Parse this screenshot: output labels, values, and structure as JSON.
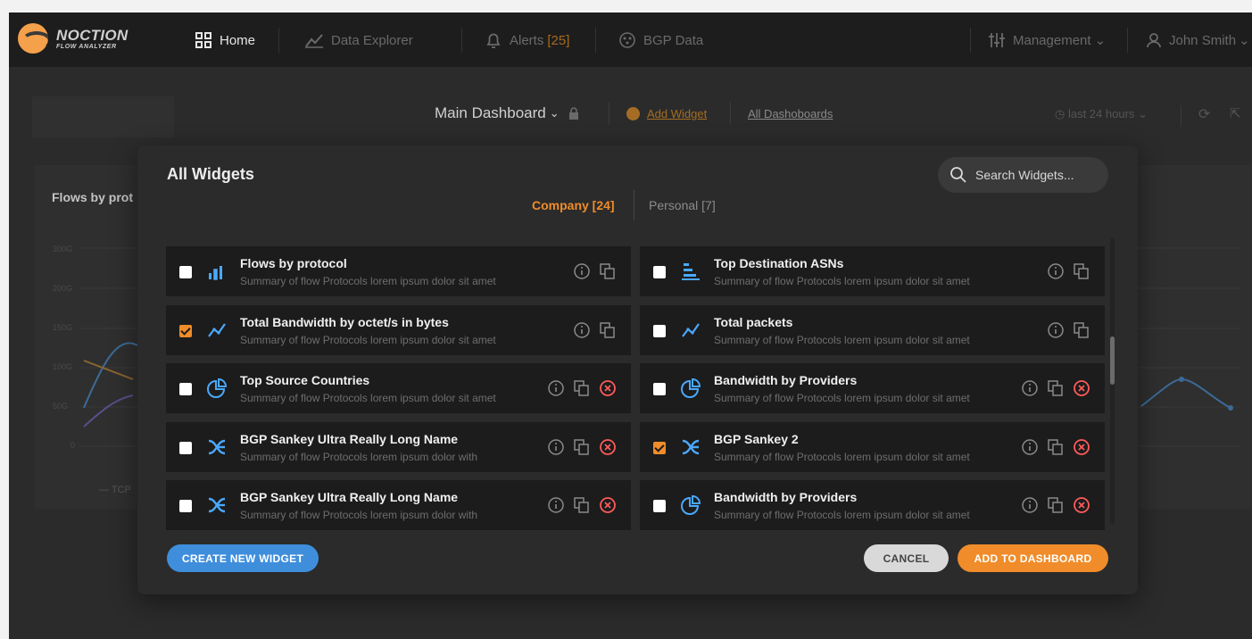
{
  "brand": {
    "name": "NOCTION",
    "sub": "FLOW ANALYZER"
  },
  "nav": {
    "home": "Home",
    "data_explorer": "Data Explorer",
    "alerts": "Alerts",
    "alerts_count": "[25]",
    "bgp_data": "BGP Data",
    "management": "Management",
    "user": "John Smith"
  },
  "dashboard": {
    "title": "Main Dashboard",
    "add_widget": "Add Widget",
    "all_dashboards": "All Dashoboards",
    "time_range": "last 24 hours",
    "chart_title": "Flows by prot",
    "y_ticks": [
      "300G",
      "200G",
      "150G",
      "100G",
      "50G",
      "0"
    ],
    "legend": "TCP"
  },
  "modal": {
    "title": "All Widgets",
    "search_placeholder": "Search Widgets...",
    "tabs": {
      "company": "Company [24]",
      "personal": "Personal [7]"
    },
    "widgets": [
      {
        "title": "Flows by protocol",
        "desc": "Summary of flow Protocols lorem ipsum dolor sit amet",
        "icon": "bar-chart-icon",
        "checked": false,
        "deletable": false
      },
      {
        "title": "Top Destination ASNs",
        "desc": "Summary of flow Protocols lorem ipsum dolor sit amet",
        "icon": "hbar-chart-icon",
        "checked": false,
        "deletable": false
      },
      {
        "title": "Total Bandwidth by octet/s in bytes",
        "desc": "Summary of flow Protocols lorem ipsum dolor sit amet",
        "icon": "line-chart-icon",
        "checked": true,
        "deletable": false
      },
      {
        "title": "Total packets",
        "desc": "Summary of flow Protocols lorem ipsum dolor sit amet",
        "icon": "line-chart-icon",
        "checked": false,
        "deletable": false
      },
      {
        "title": "Top Source Countries",
        "desc": "Summary of flow Protocols lorem ipsum dolor sit amet",
        "icon": "pie-chart-icon",
        "checked": false,
        "deletable": true
      },
      {
        "title": "Bandwidth by Providers",
        "desc": "Summary of flow Protocols lorem ipsum dolor sit amet",
        "icon": "pie-chart-icon",
        "checked": false,
        "deletable": true
      },
      {
        "title": "BGP Sankey Ultra Really Long Name",
        "desc": "Summary of flow Protocols lorem ipsum dolor with",
        "icon": "sankey-icon",
        "checked": false,
        "deletable": true
      },
      {
        "title": "BGP Sankey 2",
        "desc": "Summary of flow Protocols lorem ipsum dolor sit amet",
        "icon": "sankey-icon",
        "checked": true,
        "deletable": true
      },
      {
        "title": "BGP Sankey Ultra Really Long Name",
        "desc": "Summary of flow Protocols lorem ipsum dolor with",
        "icon": "sankey-icon",
        "checked": false,
        "deletable": true
      },
      {
        "title": "Bandwidth by Providers",
        "desc": "Summary of flow Protocols lorem ipsum dolor sit amet",
        "icon": "pie-chart-icon",
        "checked": false,
        "deletable": true
      }
    ],
    "buttons": {
      "create": "CREATE NEW WIDGET",
      "cancel": "CANCEL",
      "add": "ADD TO DASHBOARD"
    }
  },
  "colors": {
    "accent": "#f08c2a",
    "primary": "#3f8edc",
    "icon_blue": "#4aa8ff",
    "danger": "#ff5a5a"
  }
}
